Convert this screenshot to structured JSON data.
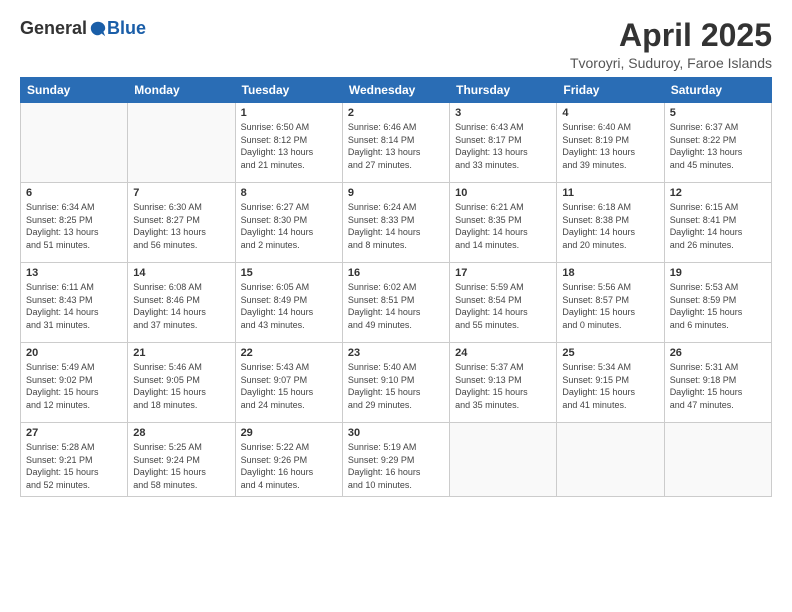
{
  "header": {
    "logo_general": "General",
    "logo_blue": "Blue",
    "title": "April 2025",
    "subtitle": "Tvoroyri, Suduroy, Faroe Islands"
  },
  "days_of_week": [
    "Sunday",
    "Monday",
    "Tuesday",
    "Wednesday",
    "Thursday",
    "Friday",
    "Saturday"
  ],
  "weeks": [
    [
      {
        "day": "",
        "info": ""
      },
      {
        "day": "",
        "info": ""
      },
      {
        "day": "1",
        "info": "Sunrise: 6:50 AM\nSunset: 8:12 PM\nDaylight: 13 hours\nand 21 minutes."
      },
      {
        "day": "2",
        "info": "Sunrise: 6:46 AM\nSunset: 8:14 PM\nDaylight: 13 hours\nand 27 minutes."
      },
      {
        "day": "3",
        "info": "Sunrise: 6:43 AM\nSunset: 8:17 PM\nDaylight: 13 hours\nand 33 minutes."
      },
      {
        "day": "4",
        "info": "Sunrise: 6:40 AM\nSunset: 8:19 PM\nDaylight: 13 hours\nand 39 minutes."
      },
      {
        "day": "5",
        "info": "Sunrise: 6:37 AM\nSunset: 8:22 PM\nDaylight: 13 hours\nand 45 minutes."
      }
    ],
    [
      {
        "day": "6",
        "info": "Sunrise: 6:34 AM\nSunset: 8:25 PM\nDaylight: 13 hours\nand 51 minutes."
      },
      {
        "day": "7",
        "info": "Sunrise: 6:30 AM\nSunset: 8:27 PM\nDaylight: 13 hours\nand 56 minutes."
      },
      {
        "day": "8",
        "info": "Sunrise: 6:27 AM\nSunset: 8:30 PM\nDaylight: 14 hours\nand 2 minutes."
      },
      {
        "day": "9",
        "info": "Sunrise: 6:24 AM\nSunset: 8:33 PM\nDaylight: 14 hours\nand 8 minutes."
      },
      {
        "day": "10",
        "info": "Sunrise: 6:21 AM\nSunset: 8:35 PM\nDaylight: 14 hours\nand 14 minutes."
      },
      {
        "day": "11",
        "info": "Sunrise: 6:18 AM\nSunset: 8:38 PM\nDaylight: 14 hours\nand 20 minutes."
      },
      {
        "day": "12",
        "info": "Sunrise: 6:15 AM\nSunset: 8:41 PM\nDaylight: 14 hours\nand 26 minutes."
      }
    ],
    [
      {
        "day": "13",
        "info": "Sunrise: 6:11 AM\nSunset: 8:43 PM\nDaylight: 14 hours\nand 31 minutes."
      },
      {
        "day": "14",
        "info": "Sunrise: 6:08 AM\nSunset: 8:46 PM\nDaylight: 14 hours\nand 37 minutes."
      },
      {
        "day": "15",
        "info": "Sunrise: 6:05 AM\nSunset: 8:49 PM\nDaylight: 14 hours\nand 43 minutes."
      },
      {
        "day": "16",
        "info": "Sunrise: 6:02 AM\nSunset: 8:51 PM\nDaylight: 14 hours\nand 49 minutes."
      },
      {
        "day": "17",
        "info": "Sunrise: 5:59 AM\nSunset: 8:54 PM\nDaylight: 14 hours\nand 55 minutes."
      },
      {
        "day": "18",
        "info": "Sunrise: 5:56 AM\nSunset: 8:57 PM\nDaylight: 15 hours\nand 0 minutes."
      },
      {
        "day": "19",
        "info": "Sunrise: 5:53 AM\nSunset: 8:59 PM\nDaylight: 15 hours\nand 6 minutes."
      }
    ],
    [
      {
        "day": "20",
        "info": "Sunrise: 5:49 AM\nSunset: 9:02 PM\nDaylight: 15 hours\nand 12 minutes."
      },
      {
        "day": "21",
        "info": "Sunrise: 5:46 AM\nSunset: 9:05 PM\nDaylight: 15 hours\nand 18 minutes."
      },
      {
        "day": "22",
        "info": "Sunrise: 5:43 AM\nSunset: 9:07 PM\nDaylight: 15 hours\nand 24 minutes."
      },
      {
        "day": "23",
        "info": "Sunrise: 5:40 AM\nSunset: 9:10 PM\nDaylight: 15 hours\nand 29 minutes."
      },
      {
        "day": "24",
        "info": "Sunrise: 5:37 AM\nSunset: 9:13 PM\nDaylight: 15 hours\nand 35 minutes."
      },
      {
        "day": "25",
        "info": "Sunrise: 5:34 AM\nSunset: 9:15 PM\nDaylight: 15 hours\nand 41 minutes."
      },
      {
        "day": "26",
        "info": "Sunrise: 5:31 AM\nSunset: 9:18 PM\nDaylight: 15 hours\nand 47 minutes."
      }
    ],
    [
      {
        "day": "27",
        "info": "Sunrise: 5:28 AM\nSunset: 9:21 PM\nDaylight: 15 hours\nand 52 minutes."
      },
      {
        "day": "28",
        "info": "Sunrise: 5:25 AM\nSunset: 9:24 PM\nDaylight: 15 hours\nand 58 minutes."
      },
      {
        "day": "29",
        "info": "Sunrise: 5:22 AM\nSunset: 9:26 PM\nDaylight: 16 hours\nand 4 minutes."
      },
      {
        "day": "30",
        "info": "Sunrise: 5:19 AM\nSunset: 9:29 PM\nDaylight: 16 hours\nand 10 minutes."
      },
      {
        "day": "",
        "info": ""
      },
      {
        "day": "",
        "info": ""
      },
      {
        "day": "",
        "info": ""
      }
    ]
  ]
}
